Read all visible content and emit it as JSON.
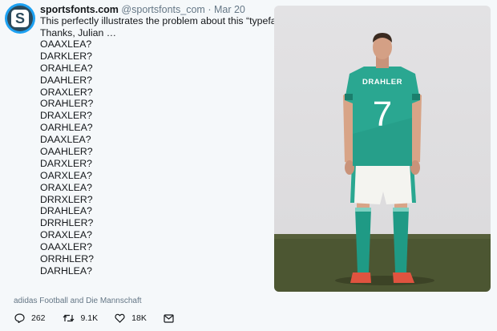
{
  "header": {
    "name": "sportsfonts.com",
    "handle": "@sportsfonts_com",
    "separator": "·",
    "date": "Mar 20"
  },
  "avatar": {
    "letter": "S",
    "icon": "sportsfonts-logo"
  },
  "tweet": {
    "lines": [
      "This perfectly illustrates the problem about this “typeface”.",
      "Thanks, Julian …"
    ],
    "variants": [
      "OAAXLEA?",
      "DARKLER?",
      "ORAHLEA?",
      "DAAHLER?",
      "ORAXLER?",
      "ORAHLER?",
      "DRAXLER?",
      "OARHLEA?",
      "DAAXLEA?",
      "OAAHLER?",
      "DARXLER?",
      "OARXLEA?",
      "ORAXLEA?",
      "DRRXLER?",
      "DRAHLEA?",
      "DRRHLER?",
      "ORAXLEA?",
      "OAAXLER?",
      "ORRHLER?",
      "DARHLEA?"
    ]
  },
  "media": {
    "jersey_name": "DRAHLER",
    "jersey_number": "7",
    "colors": {
      "jersey": "#2aa791",
      "shorts": "#f4f4f0",
      "socks": "#1f9a85",
      "grass": "#4c5632",
      "boots": "#e0533f"
    }
  },
  "credit": "adidas Football and Die Mannschaft",
  "actions": {
    "reply": {
      "icon": "reply-icon",
      "count": "262"
    },
    "retweet": {
      "icon": "retweet-icon",
      "count": "9.1K"
    },
    "like": {
      "icon": "heart-icon",
      "count": "18K"
    },
    "dm": {
      "icon": "mail-icon"
    }
  }
}
